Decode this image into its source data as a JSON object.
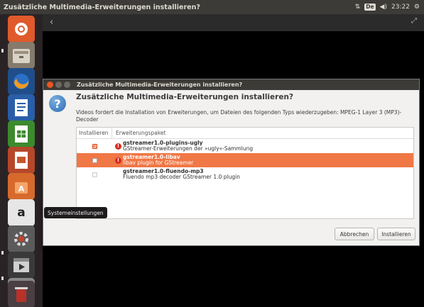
{
  "top_panel": {
    "window_title": "Zusätzliche Multimedia-Erweiterungen installieren?",
    "keyboard_layout": "De",
    "clock": "23:22",
    "icons": [
      "network-updown-icon",
      "keyboard-layout-icon",
      "volume-icon",
      "settings-gear-icon"
    ]
  },
  "launcher": {
    "items": [
      "ubuntu-dash-icon",
      "files-icon",
      "firefox-icon",
      "writer-icon",
      "calc-icon",
      "impress-icon",
      "software-center-icon",
      "amazon-icon",
      "system-settings-icon",
      "videos-icon",
      "unknown-app-icon",
      "trash-icon"
    ],
    "tooltip": "Systemeinstellungen"
  },
  "player": {
    "back_glyph": "‹",
    "fullscreen_glyph": "⤢"
  },
  "dialog": {
    "title": "Zusätzliche Multimedia-Erweiterungen installieren?",
    "heading": "Zusätzliche Multimedia-Erweiterungen installieren?",
    "description": "Videos fordert die Installation von Erweiterungen, um Dateien des folgenden Typs wiederzugeben: MPEG-1 Layer 3 (MP3)-Decoder",
    "columns": {
      "install": "Installieren",
      "package": "Erweiterungspaket"
    },
    "rows": [
      {
        "name": "gstreamer1.0-plugins-ugly",
        "description": "GStreamer-Erweiterungen der »ugly«-Sammlung",
        "checked": true,
        "warning": true
      },
      {
        "name": "gstreamer1.0-libav",
        "description": "libav plugin for GStreamer",
        "checked": false,
        "warning": true,
        "selected": true
      },
      {
        "name": "gstreamer1.0-fluendo-mp3",
        "description": "Fluendo mp3 decoder GStreamer 1.0 plugin",
        "checked": false,
        "warning": false
      }
    ],
    "buttons": {
      "cancel": "Abbrechen",
      "install": "Installieren"
    }
  },
  "colors": {
    "accent": "#dd4814",
    "selection": "#f07746",
    "panel": "#3c3b37",
    "launcher": "#2a2326"
  }
}
